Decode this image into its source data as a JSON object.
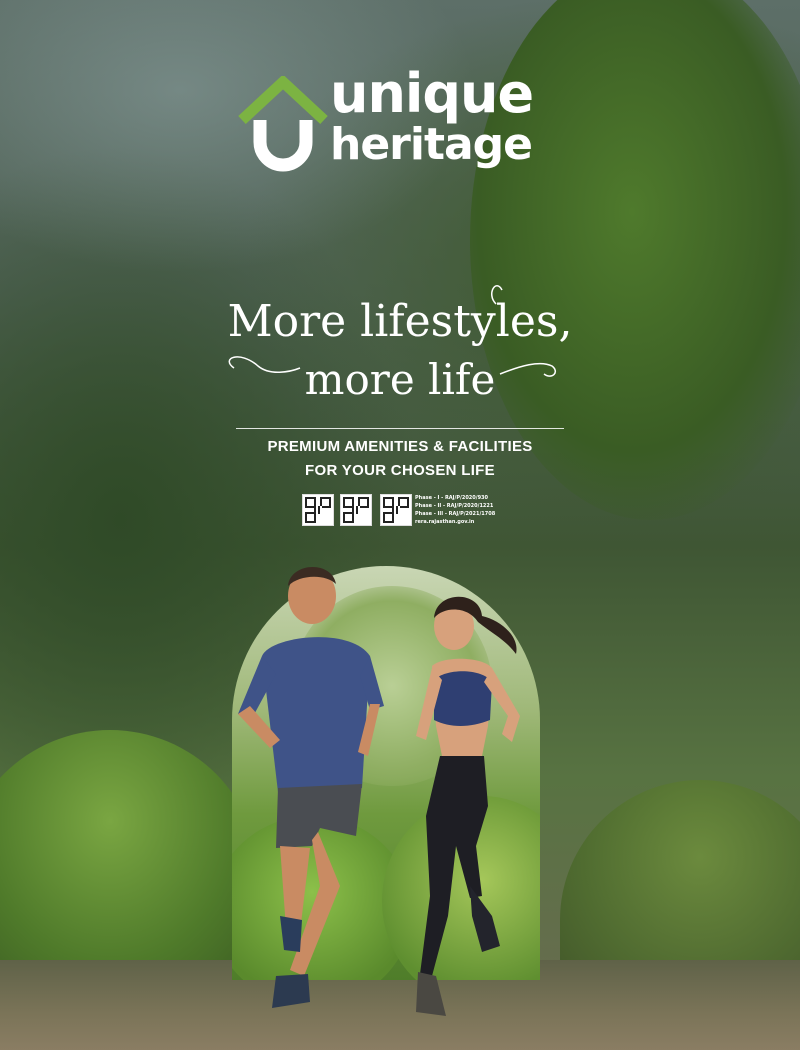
{
  "brand": {
    "name_line1": "unique",
    "name_line2": "heritage",
    "house_color": "#7cb342",
    "text_color": "#ffffff"
  },
  "headline": {
    "line1": "More lifestyles,",
    "line2": "more life"
  },
  "tagline": {
    "line1": "PREMIUM AMENITIES & FACILITIES",
    "line2": "FOR YOUR CHOSEN LIFE"
  },
  "qr_codes": [
    {
      "icon": "qr-code-icon"
    },
    {
      "icon": "qr-code-icon"
    },
    {
      "icon": "qr-code-icon"
    }
  ],
  "rera": {
    "line1": "Phase - I - RAJ/P/2020/930",
    "line2": "Phase - II - RAJ/P/2020/1221",
    "line3": "Phase - III - RAJ/P/2021/1708",
    "line4": "rera.rajasthan.gov.in"
  },
  "photo": {
    "subject": "man-and-woman-jogging"
  }
}
